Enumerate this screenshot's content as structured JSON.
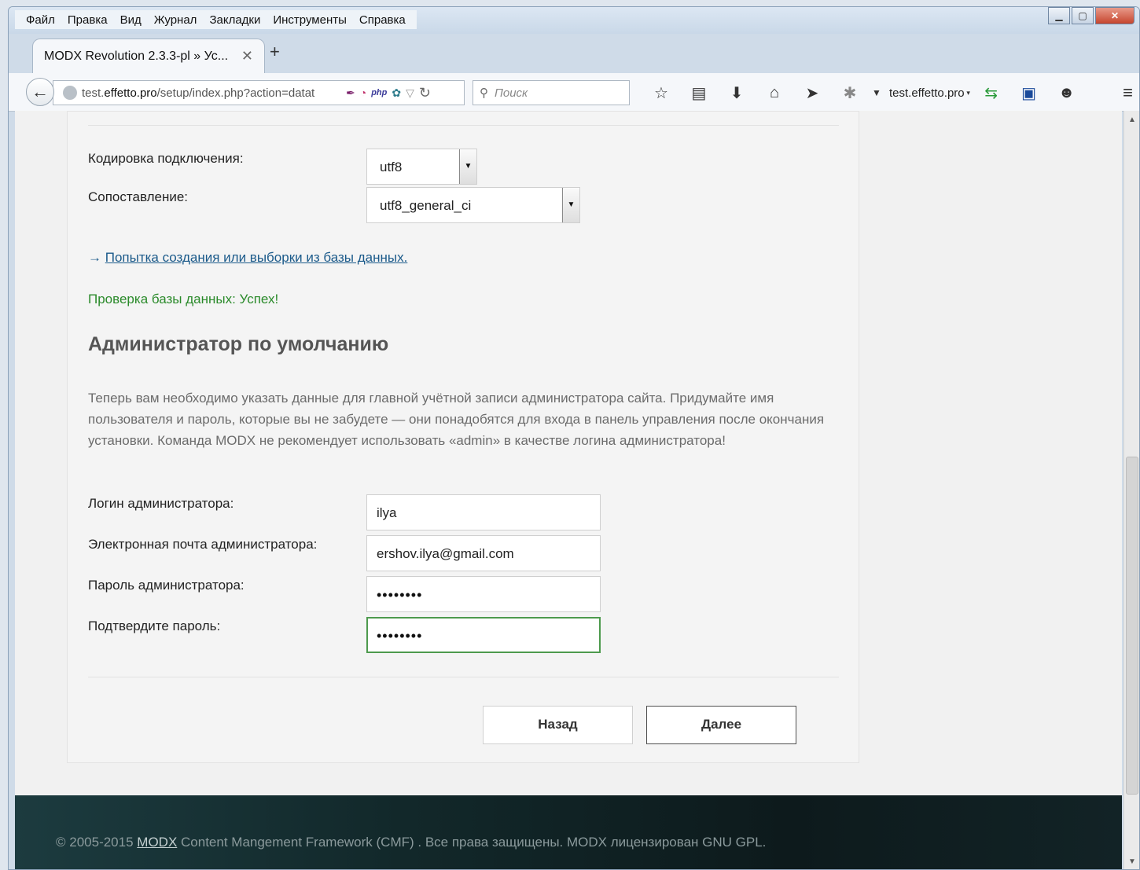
{
  "menu": [
    "Файл",
    "Правка",
    "Вид",
    "Журнал",
    "Закладки",
    "Инструменты",
    "Справка"
  ],
  "tab": {
    "title": "MODX Revolution 2.3.3-pl » Ус..."
  },
  "url": {
    "prefix": "test.",
    "domain": "effetto.pro",
    "path": "/setup/index.php?action=datat"
  },
  "search": {
    "placeholder": "Поиск"
  },
  "site_dropdown": "test.effetto.pro",
  "form": {
    "charset_label": "Кодировка подключения:",
    "charset_value": "utf8",
    "collation_label": "Сопоставление:",
    "collation_value": "utf8_general_ci",
    "db_link_prefix": "→",
    "db_link": "Попытка создания или выборки из базы данных.",
    "db_status": "Проверка базы данных: Успех!",
    "admin_heading": "Администратор по умолчанию",
    "admin_intro": "Теперь вам необходимо указать данные для главной учётной записи администратора сайта. Придумайте имя пользователя и пароль, которые вы не забудете — они понадобятся для входа в панель управления после окончания установки. Команда MODX не рекомендует использовать «admin» в качестве логина администратора!",
    "login_label": "Логин администратора:",
    "login_value": "ilya",
    "email_label": "Электронная почта администратора:",
    "email_value": "ershov.ilya@gmail.com",
    "password_label": "Пароль администратора:",
    "password_value": "••••••••",
    "confirm_label": "Подтвердите пароль:",
    "confirm_value": "••••••••",
    "back_button": "Назад",
    "next_button": "Далее"
  },
  "footer": {
    "prefix": "© 2005-2015",
    "link": "MODX",
    "rest": "Content Mangement Framework (CMF) . Все права защищены. MODX лицензирован GNU GPL."
  }
}
